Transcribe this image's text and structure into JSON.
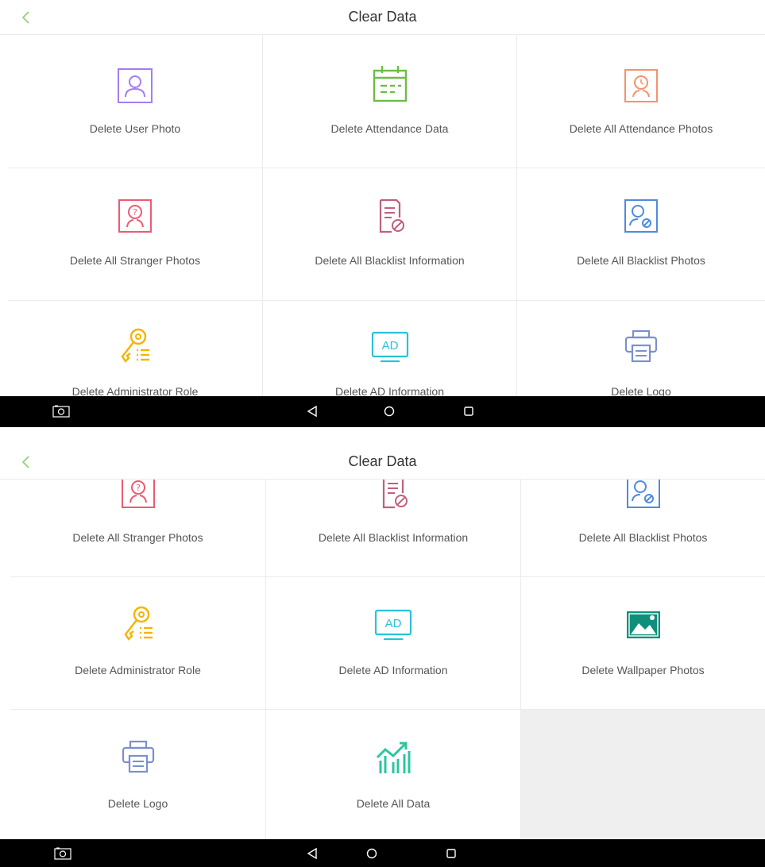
{
  "screens": [
    {
      "header": {
        "title": "Clear Data"
      },
      "tiles": [
        {
          "label": "Delete User Photo",
          "icon": "user-photo-icon"
        },
        {
          "label": "Delete Attendance Data",
          "icon": "calendar-icon"
        },
        {
          "label": "Delete All Attendance Photos",
          "icon": "attendance-photo-icon"
        },
        {
          "label": "Delete All Stranger Photos",
          "icon": "stranger-photo-icon"
        },
        {
          "label": "Delete All Blacklist Information",
          "icon": "blacklist-document-icon"
        },
        {
          "label": "Delete All Blacklist Photos",
          "icon": "blacklist-user-icon"
        },
        {
          "label": "Delete Administrator Role",
          "icon": "key-list-icon"
        },
        {
          "label": "Delete AD Information",
          "icon": "ad-monitor-icon"
        },
        {
          "label": "Delete Logo",
          "icon": "printer-icon"
        }
      ]
    },
    {
      "header": {
        "title": "Clear Data"
      },
      "tiles": [
        {
          "label": "Delete All Stranger Photos",
          "icon": "stranger-photo-icon"
        },
        {
          "label": "Delete All Blacklist Information",
          "icon": "blacklist-document-icon"
        },
        {
          "label": "Delete All Blacklist Photos",
          "icon": "blacklist-user-icon"
        },
        {
          "label": "Delete Administrator Role",
          "icon": "key-list-icon"
        },
        {
          "label": "Delete AD Information",
          "icon": "ad-monitor-icon"
        },
        {
          "label": "Delete Wallpaper Photos",
          "icon": "wallpaper-image-icon"
        },
        {
          "label": "Delete Logo",
          "icon": "printer-icon"
        },
        {
          "label": "Delete All Data",
          "icon": "chart-growth-icon"
        }
      ]
    }
  ],
  "icons": {
    "ad_text": "AD"
  },
  "colors": {
    "back_arrow": "#8bd06c",
    "user_photo": "#a67cf0",
    "calendar": "#6dbd45",
    "attendance_photo": "#f5926b",
    "stranger": "#ee5a72",
    "blacklist_doc": "#c0607c",
    "blacklist_user": "#4f8ae0",
    "key": "#f4b400",
    "ad": "#29c2d8",
    "printer": "#7b8fd0",
    "wallpaper": "#0e8f7b",
    "chart": "#2ec4a0"
  }
}
